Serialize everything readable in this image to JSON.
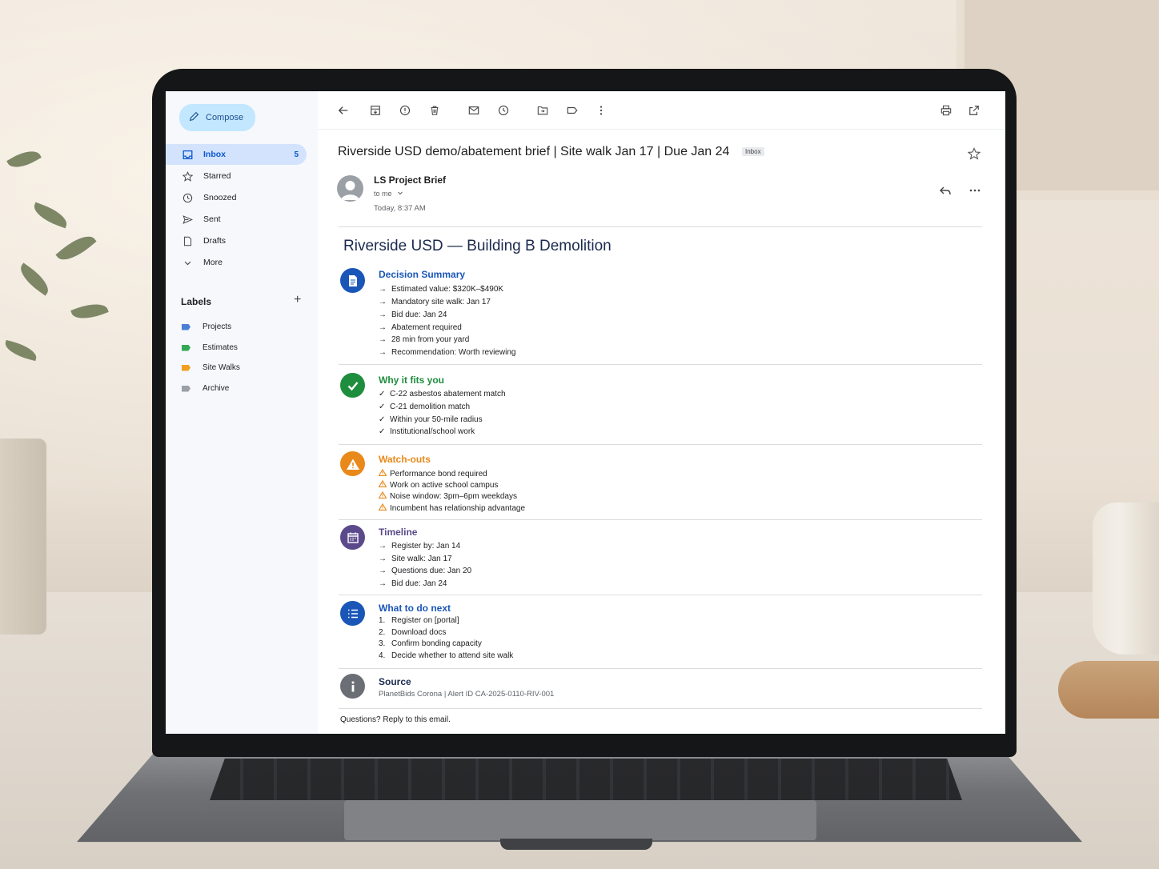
{
  "sidebar": {
    "compose_label": "Compose",
    "nav": [
      {
        "label": "Inbox",
        "count": "5",
        "icon": "inbox-icon"
      },
      {
        "label": "Starred",
        "icon": "star-icon"
      },
      {
        "label": "Snoozed",
        "icon": "clock-icon"
      },
      {
        "label": "Sent",
        "icon": "send-icon"
      },
      {
        "label": "Drafts",
        "icon": "draft-icon"
      },
      {
        "label": "More",
        "icon": "chevron-down-icon"
      }
    ],
    "labels_heading": "Labels",
    "labels": [
      {
        "label": "Projects",
        "color": "#4a7fd6"
      },
      {
        "label": "Estimates",
        "color": "#34a853"
      },
      {
        "label": "Site Walks",
        "color": "#f0a020"
      },
      {
        "label": "Archive",
        "color": "#9aa0a6"
      }
    ]
  },
  "email": {
    "subject": "Riverside USD demo/abatement brief | Site walk Jan 17 | Due Jan 24",
    "folder_chip": "Inbox",
    "sender": "LS Project Brief",
    "recipient": "to me",
    "time": "Today, 8:37 AM",
    "brief_title": "Riverside USD — Building B Demolition",
    "sections": {
      "decision": {
        "title": "Decision Summary",
        "color": "#1a56b8",
        "items": [
          "Estimated value: $320K–$490K",
          "Mandatory site walk: Jan 17",
          "Bid due: Jan 24",
          "Abatement required",
          "28 min from your yard",
          "Recommendation: Worth reviewing"
        ]
      },
      "fits": {
        "title": "Why it fits you",
        "color": "#1e8e3e",
        "items": [
          "C-22 asbestos abatement match",
          "C-21 demolition match",
          "Within your 50-mile radius",
          "Institutional/school work"
        ]
      },
      "watch": {
        "title": "Watch-outs",
        "color": "#e8891a",
        "items": [
          "Performance bond required",
          "Work on active school campus",
          "Noise window: 3pm–6pm weekdays",
          "Incumbent has relationship advantage"
        ]
      },
      "timeline": {
        "title": "Timeline",
        "color": "#5b4a8b",
        "items": [
          "Register by: Jan 14",
          "Site walk: Jan 17",
          "Questions due: Jan 20",
          "Bid due: Jan 24"
        ]
      },
      "next": {
        "title": "What to do next",
        "color": "#1a56b8",
        "items": [
          "Register on [portal]",
          "Download docs",
          "Confirm bonding capacity",
          "Decide whether to attend site walk"
        ],
        "numbers": [
          "1.",
          "2.",
          "3.",
          "4."
        ]
      },
      "source": {
        "title": "Source",
        "color": "#1b2a4e",
        "text": "PlanetBids Corona | Alert ID CA-2025-0110-RIV-001"
      }
    },
    "footer": "Questions? Reply to this email."
  }
}
